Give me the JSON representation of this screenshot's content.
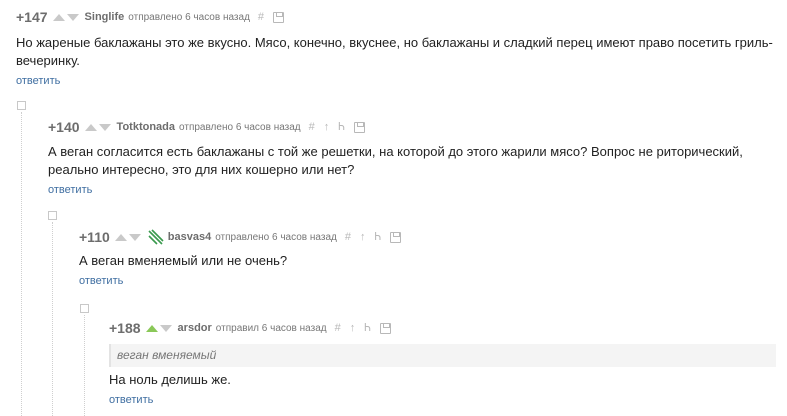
{
  "comments": [
    {
      "rating": "+147",
      "author": "Singlife",
      "posted": "отправлено 6 часов назад",
      "text": "Но жареные баклажаны это же вкусно. Мясо, конечно, вкуснее, но баклажаны и сладкий перец имеют право посетить гриль-вечеринку.",
      "reply": "ответить",
      "tools": {
        "link": "#"
      }
    },
    {
      "rating": "+140",
      "author": "Totktonada",
      "posted": "отправлено 6 часов назад",
      "text": "А веган согласится есть баклажаны с той же решетки, на которой до этого жарили мясо? Вопрос не риторический, реально интересно, это для них кошерно или нет?",
      "reply": "ответить",
      "tools": {
        "link": "#"
      }
    },
    {
      "rating": "+110",
      "author": "basvas4",
      "posted": "отправлено 6 часов назад",
      "text": "А веган вменяемый или не очень?",
      "reply": "ответить",
      "tools": {
        "link": "#"
      }
    },
    {
      "rating": "+188",
      "author": "arsdor",
      "posted": "отправил 6 часов назад",
      "quote": "веган вменяемый",
      "text": "На ноль делишь же.",
      "reply": "ответить",
      "tools": {
        "link": "#"
      },
      "upvoted": true
    }
  ],
  "collapse_symbol": "⊟",
  "colors": {
    "upvote_active": "#8ac858",
    "reply_link": "#3f6ea1",
    "avatar": "#3a9a4e"
  }
}
